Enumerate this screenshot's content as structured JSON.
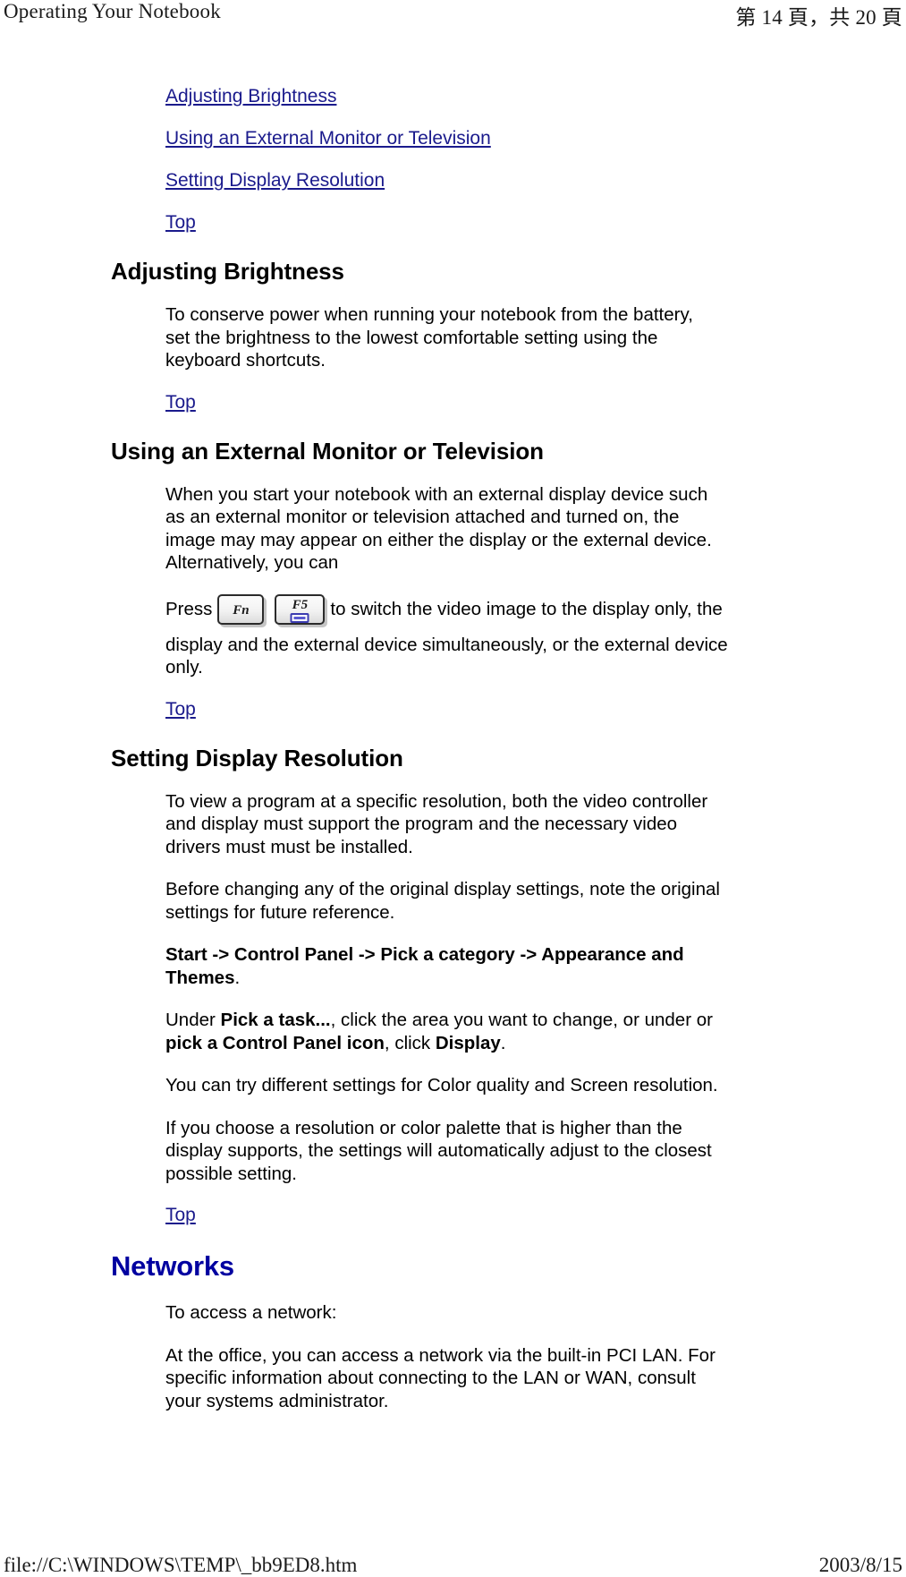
{
  "print_header": {
    "left": "Operating Your Notebook",
    "right": "第 14 頁，共 20 頁"
  },
  "print_footer": {
    "left": "file://C:\\WINDOWS\\TEMP\\_bb9ED8.htm",
    "right": "2003/8/15"
  },
  "colors": {
    "link": "#1a1a8c",
    "main_heading": "#0000a0",
    "text": "#000000",
    "key_glyph": "#5a5ad0"
  },
  "toc_links": [
    {
      "label": "Adjusting Brightness"
    },
    {
      "label": "Using an External Monitor or Television"
    },
    {
      "label": "Setting Display Resolution"
    }
  ],
  "top_link_label": "Top",
  "sections": {
    "adjusting_brightness": {
      "heading": "Adjusting Brightness",
      "paragraph": "To conserve power when running your notebook from the battery, set the brightness to the lowest comfortable setting using the keyboard shortcuts."
    },
    "external_monitor": {
      "heading": "Using an External Monitor or Television",
      "paragraph": "When you start your notebook with an external display device such as an external monitor or television attached and turned on, the image may may appear on either the display or the external device. Alternatively, you can",
      "key_instruction": {
        "prefix": "Press",
        "key1": "Fn",
        "key2": "F5",
        "key2_icon": "monitor-icon",
        "suffix": "to switch the video image to the display only, the",
        "continuation": "display and the external device simultaneously, or the external device only."
      }
    },
    "display_resolution": {
      "heading": "Setting Display Resolution",
      "paragraph_1": "To view a program at a specific resolution, both the video controller and display must support the program and the necessary video drivers must must be installed.",
      "paragraph_2": "Before changing any of the original display settings, note the original settings for future reference.",
      "path_bold": "Start -> Control Panel -> Pick a category -> Appearance and Themes",
      "path_suffix": ".",
      "task_line": {
        "part1": "Under ",
        "bold1": "Pick a task...",
        "part2": ", click the area you want to change, or under or ",
        "bold2": "pick a Control Panel icon",
        "part3": ", click ",
        "bold3": "Display",
        "part4": "."
      },
      "paragraph_3": "You can try different settings for Color quality and Screen resolution.",
      "paragraph_4": "If you choose a resolution or color palette that is higher than the display supports, the settings will automatically adjust to the closest possible setting."
    },
    "networks": {
      "heading": "Networks",
      "paragraph_1": "To access a network:",
      "paragraph_2": "At the office, you can access a network via the built-in PCI LAN. For specific information about connecting to the LAN or WAN, consult your systems administrator."
    }
  }
}
